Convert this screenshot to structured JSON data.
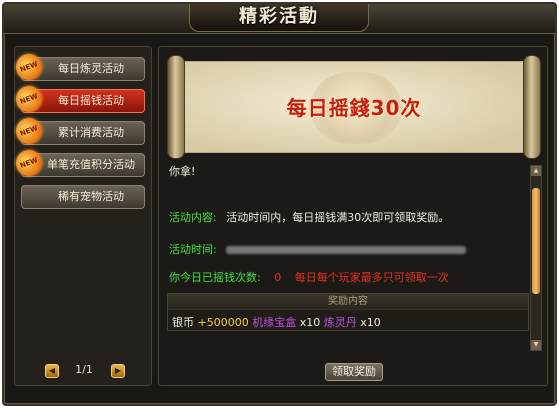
{
  "window": {
    "title": "精彩活動",
    "close_glyph": "✕"
  },
  "sidebar": {
    "items": [
      {
        "label": "每日炼灵活动",
        "badge": "NEW",
        "active": false
      },
      {
        "label": "每日摇钱活动",
        "badge": "NEW",
        "active": true
      },
      {
        "label": "累计消费活动",
        "badge": "NEW",
        "active": false
      },
      {
        "label": "单笔充值积分活动",
        "badge": "NEW",
        "active": false
      },
      {
        "label": "稀有宠物活动",
        "badge": "",
        "active": false
      }
    ],
    "pager": {
      "prev_glyph": "◀",
      "next_glyph": "▶",
      "text": "1/1"
    }
  },
  "banner": {
    "title": "每日摇錢30次"
  },
  "details": {
    "intro_text": "你拿!",
    "content_label": "活动内容:",
    "content_value": "活动时间内，每日摇钱满30次即可领取奖励。",
    "time_label": "活动时间:",
    "count_label": "你今日已摇钱次数:",
    "count_value": "0",
    "count_note": "每日每个玩家最多只可领取一次"
  },
  "reward": {
    "header": "奖励内容",
    "currency_label": "银币",
    "currency_amount": "+500000",
    "item1_name": "机缘宝盒",
    "item1_qty": "x10",
    "item2_name": "炼灵丹",
    "item2_qty": "x10"
  },
  "actions": {
    "claim_label": "领取奖励"
  },
  "colors": {
    "active_tab": "#d2321e",
    "label_green": "#40e040",
    "accent_red": "#e83020",
    "item_purple": "#c050e0",
    "amount_yellow": "#f0d040"
  }
}
